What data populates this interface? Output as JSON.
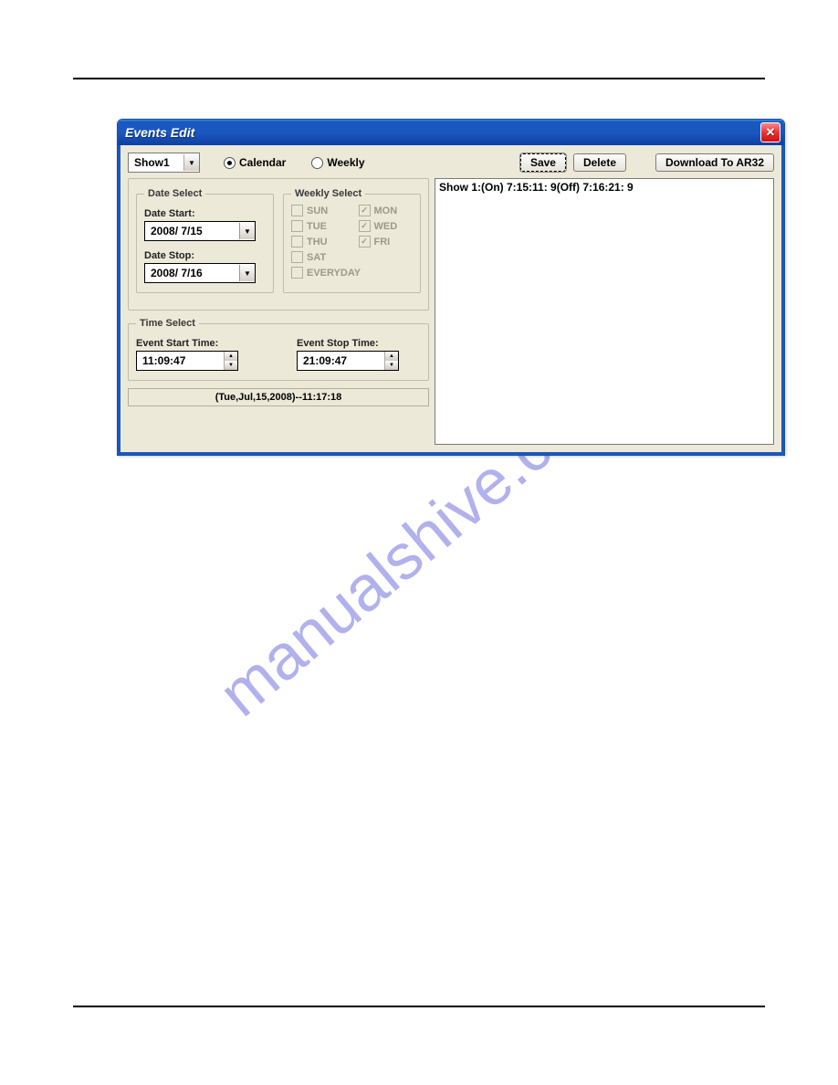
{
  "watermark": "manualshive.com",
  "window": {
    "title": "Events Edit"
  },
  "toolbar": {
    "show_combo": "Show1",
    "radio_calendar": "Calendar",
    "radio_weekly": "Weekly",
    "radio_selected": "calendar",
    "save_label": "Save",
    "delete_label": "Delete",
    "download_label": "Download To AR32"
  },
  "listbox": {
    "items": [
      "Show 1:(On) 7:15:11: 9(Off) 7:16:21: 9"
    ]
  },
  "date_select": {
    "legend": "Date Select",
    "start_label": "Date Start:",
    "start_value": "2008/ 7/15",
    "stop_label": "Date Stop:",
    "stop_value": "2008/ 7/16"
  },
  "weekly_select": {
    "legend": "Weekly Select",
    "days": {
      "sun": {
        "label": "SUN",
        "checked": false
      },
      "mon": {
        "label": "MON",
        "checked": true
      },
      "tue": {
        "label": "TUE",
        "checked": false
      },
      "wed": {
        "label": "WED",
        "checked": true
      },
      "thu": {
        "label": "THU",
        "checked": false
      },
      "fri": {
        "label": "FRI",
        "checked": true
      },
      "sat": {
        "label": "SAT",
        "checked": false
      },
      "everyday": {
        "label": "EVERYDAY",
        "checked": false
      }
    }
  },
  "time_select": {
    "legend": "Time Select",
    "start_label": "Event Start Time:",
    "start_value": "11:09:47",
    "stop_label": "Event Stop Time:",
    "stop_value": "21:09:47"
  },
  "status": "(Tue,Jul,15,2008)--11:17:18"
}
